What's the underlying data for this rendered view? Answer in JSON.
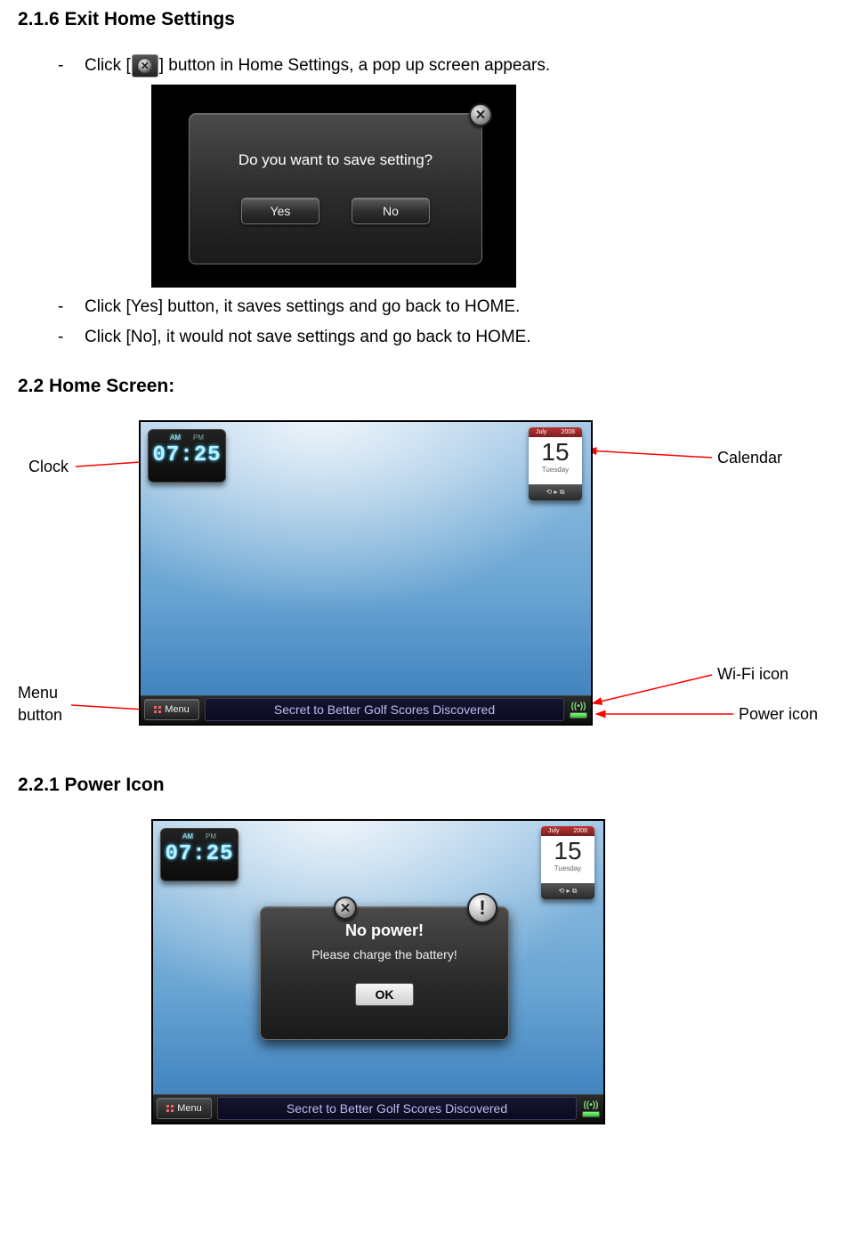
{
  "section_216": {
    "title": "2.1.6 Exit Home Settings"
  },
  "bullets216": {
    "b1_pre": "Click [",
    "b1_post": "] button in Home Settings, a pop up screen appears.",
    "b2": "Click [Yes] button, it saves settings and go back to HOME.",
    "b3": "Click [No], it would not save settings and go back to HOME."
  },
  "dialog1": {
    "message": "Do you want to save setting?",
    "yes": "Yes",
    "no": "No"
  },
  "section_22": {
    "title": "2.2 Home Screen:"
  },
  "callouts": {
    "clock": "Clock",
    "calendar": "Calendar",
    "menu_button": "Menu button",
    "wifi": "Wi-Fi icon",
    "power": "Power icon"
  },
  "homescreen": {
    "clock": {
      "am": "AM",
      "pm": "PM",
      "time": "07:25"
    },
    "calendar": {
      "month": "July",
      "year": "2008",
      "day": "15",
      "dow": "Tuesday",
      "foot": "⟲ ▸ ⧉"
    },
    "menubar": {
      "menu_label": "Menu",
      "ticker": "Secret to Better Golf Scores Discovered",
      "wifi_glyph": "((•))"
    }
  },
  "section_221": {
    "title": "2.2.1 Power Icon"
  },
  "powerdialog": {
    "title": "No power!",
    "subtitle": "Please charge the battery!",
    "ok": "OK"
  }
}
